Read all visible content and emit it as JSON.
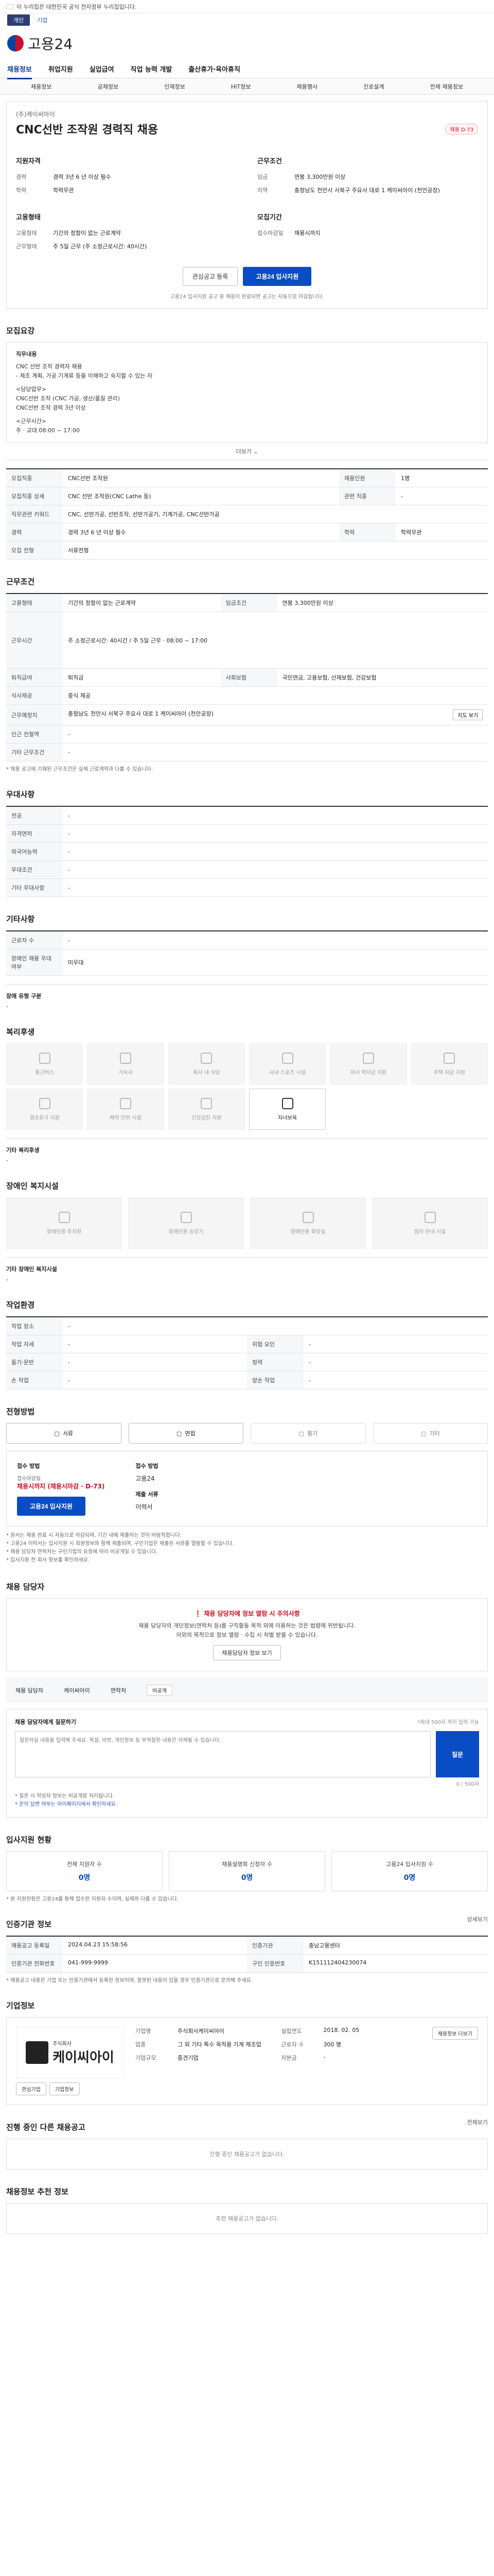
{
  "topbar": {
    "notice": "이 누리집은 대한민국 공식 전자정부 누리집입니다."
  },
  "topbar2": {
    "personal": "개인",
    "corporate": "기업"
  },
  "logo": {
    "text": "고용24"
  },
  "gnb": [
    "채용정보",
    "취업지원",
    "실업급여",
    "직업 능력 개발",
    "출산휴가·육아휴직"
  ],
  "subnav": [
    "채용정보",
    "공채정보",
    "인재정보",
    "HIT정보",
    "채용행사",
    "진로설계",
    "전체 채용정보"
  ],
  "job": {
    "company": "(주)케이씨아이",
    "title": "CNC선반 조작원 경력직 채용",
    "status_badge": "채용 D-73",
    "qual_title": "지원자격",
    "qual": [
      {
        "k": "경력",
        "v": "경력 3년 6 년 이상 필수"
      },
      {
        "k": "학력",
        "v": "학력무관"
      }
    ],
    "cond_title": "근무조건",
    "cond": [
      {
        "k": "임금",
        "v": "연봉 3,300만원 이상"
      },
      {
        "k": "지역",
        "v": "충청남도 천안시 서북구 주요사 대로 1 케이씨아이 (천안공장)"
      }
    ],
    "type_title": "고용형태",
    "type": [
      {
        "k": "고용형태",
        "v": "기간의 정함이 없는 근로계약"
      },
      {
        "k": "근무형태",
        "v": "주 5일 근무 (주 소정근로시간: 40시간)"
      }
    ],
    "deadline_title": "모집기간",
    "deadline": [
      {
        "k": "접수마감일",
        "v": "채용시까지"
      }
    ],
    "btn_interest": "관심공고 등록",
    "btn_apply": "고용24 입사지원",
    "note": "고용24 입사지원 공고 중 채용이 완료되면 공고는 자동으로 마감됩니다."
  },
  "recruit": {
    "heading": "모집요강",
    "detail_title": "직무내용",
    "detail_lines": [
      "CNC 선반 조작 경력자 채용",
      "- 제조 계획, 가공 기계류 등을 이해하고 숙지할 수 있는 자",
      "<담당업무>",
      "CNC선반 조작 (CNC 가공, 생산/품질 관리)",
      "CNC선반 조작 경력 3년 이상",
      "<근무시간>",
      "주 · 교대 08:00 ~ 17:00"
    ],
    "more": "더보기",
    "rows": [
      {
        "k": "모집직종",
        "v": "CNC선반 조작원",
        "k2": "채용인원",
        "v2": "1명"
      },
      {
        "k": "모집직종 상세",
        "v": "CNC 선반 조작원(CNC Lathe 등)",
        "k2": "관련 직종",
        "v2": "-"
      },
      {
        "k": "직무관련 키워드",
        "v": "CNC, 선반가공, 선반조작, 선반가공기, 기계가공, CNC선반가공",
        "k2": "",
        "v2": ""
      },
      {
        "k": "경력",
        "v": "경력 3년 6 년 이상 필수",
        "k2": "학력",
        "v2": "학력무관"
      },
      {
        "k": "모집 전형",
        "v": "서류전형",
        "k2": "",
        "v2": ""
      }
    ]
  },
  "work": {
    "heading": "근무조건",
    "rows": [
      {
        "k": "고용형태",
        "v": "기간의 정함이 없는 근로계약",
        "k2": "임금조건",
        "v2": "연봉 3,300만원 이상"
      },
      {
        "k": "근무시간",
        "v": "주 소정근로시간: 40시간 / 주 5일 근무 · 08:00 ~ 17:00",
        "k2": "",
        "v2": ""
      },
      {
        "k": "퇴직급여",
        "v": "퇴직금",
        "k2": "사회보험",
        "v2": "국민연금, 고용보험, 산재보험, 건강보험"
      },
      {
        "k": "식사제공",
        "v": "중식 제공",
        "k2": "",
        "v2": ""
      },
      {
        "k": "근무예정지",
        "v": "충청남도 천안시 서북구 주요사 대로 1 케이씨아이 (천안공장)",
        "k2": "",
        "v2": ""
      },
      {
        "k": "인근 전철역",
        "v": "-",
        "k2": "",
        "v2": ""
      },
      {
        "k": "기타 근무조건",
        "v": "-",
        "k2": "",
        "v2": ""
      }
    ],
    "map_btn": "지도 보기",
    "footnote": "* 채용 공고에 기재된 근무조건은 실제 근로계약과 다를 수 있습니다."
  },
  "prefer": {
    "heading": "우대사항",
    "rows": [
      {
        "k": "전공",
        "v": "-"
      },
      {
        "k": "자격면허",
        "v": "-"
      },
      {
        "k": "외국어능력",
        "v": "-"
      },
      {
        "k": "우대조건",
        "v": "-"
      },
      {
        "k": "기타 우대사항",
        "v": "-"
      }
    ]
  },
  "other": {
    "heading": "기타사항",
    "rows": [
      {
        "k": "근로자 수",
        "v": "-"
      },
      {
        "k": "장애인 채용 우대 여부",
        "v": "미우대"
      }
    ],
    "sub": "장애 유형 구분",
    "sub_v": "-"
  },
  "welfare": {
    "heading": "복리후생",
    "items": [
      "통근버스",
      "기숙사",
      "회사 내 식당",
      "사내 스포츠 시설",
      "자녀 학자금 지원",
      "주택 자금 지원",
      "경조휴가 지원",
      "체력 단련 시설",
      "건강검진 지원",
      "자녀보육"
    ],
    "active": [
      9
    ],
    "list_label": "기타 복리후생",
    "list_v": "-"
  },
  "disab": {
    "heading": "장애인 복지시설",
    "items": [
      "장애인용 주차장",
      "장애인용 승강기",
      "장애인용 화장실",
      "점자 안내 시설"
    ],
    "list_label": "기타 장애인 복지시설",
    "list_v": "-"
  },
  "env": {
    "heading": "작업환경",
    "rows": [
      {
        "k": "작업 장소",
        "v": "-",
        "k2": "",
        "v2": ""
      },
      {
        "k": "작업 자세",
        "v": "-",
        "k2": "위험 요인",
        "v2": "-"
      },
      {
        "k": "들기·운반",
        "v": "-",
        "k2": "청력",
        "v2": "-"
      },
      {
        "k": "손 작업",
        "v": "-",
        "k2": "양손 작업",
        "v2": "-"
      }
    ]
  },
  "method": {
    "heading": "전형방법",
    "items": [
      "서류",
      "면접",
      "필기",
      "기타"
    ],
    "active": [
      0,
      1
    ],
    "apply_title": "접수 방법",
    "apply_dead_label": "접수마감일",
    "apply_dead": "채용시까지 (채용시마감 · D-73)",
    "apply_btn": "고용24 입사지원",
    "docs_title": "접수 방법",
    "docs": "고용24",
    "docs2_title": "제출 서류",
    "docs2": "이력서",
    "bullets": [
      "* 원서는 채용 완료 시 자동으로 마감되며, 기간 내에 제출하는 것이 바람직합니다.",
      "* 고용24 이력서는 입사지원 시 회원정보와 함께 제출되며, 구인기업은 제출된 서류를 열람할 수 있습니다.",
      "* 채용 담당자 연락처는 구인기업의 요청에 따라 비공개일 수 있습니다.",
      "* 입사지원 전 회사 정보를 확인하세요."
    ]
  },
  "manager": {
    "heading": "채용 담당자",
    "warn_title": "채용 담당자에 정보 열람 시 주의사항",
    "warn_lines": [
      "채용 담당자의 개인정보(연락처 등)를 구직활동 목적 외에 이용하는 것은 법령에 위반됩니다.",
      "이외의 목적으로 정보 열람 · 수집 시 처벌 받을 수 있습니다."
    ],
    "warn_btn": "채용담당자 정보 보기",
    "mgr_label": "채용 담당자",
    "mgr_name": "케이씨아이",
    "mgr_phone_label": "연락처",
    "mgr_chip": "비공개",
    "q_title": "채용 담당자에게 질문하기",
    "q_note": "*최대 500자 까지 입력 가능",
    "q_placeholder": "질문하실 내용을 입력해 주세요. 욕설, 비방, 개인정보 등 부적절한 내용은 삭제될 수 있습니다.",
    "q_send": "질문",
    "q_count": "0 / 500자",
    "q_fn1": "* 질문 시 작성자 정보는 비공개로 처리됩니다.",
    "q_fn2": "* 문의 답변 여부는 마이페이지에서 확인하세요."
  },
  "stats": {
    "heading": "입사지원 현황",
    "items": [
      {
        "t": "전체 지원자 수",
        "n": "0명"
      },
      {
        "t": "채용설명회 신청자 수",
        "n": "0명"
      },
      {
        "t": "고용24 입사지원 수",
        "n": "0명"
      }
    ],
    "fn": "* 본 지원현황은 고용24를 통해 접수된 지원자 수이며, 실제와 다를 수 있습니다."
  },
  "org": {
    "heading": "인증기관 정보",
    "link": "상세보기",
    "rows": [
      {
        "k": "채용공고 등록일",
        "v": "2024.04.23 15:58:56"
      },
      {
        "k": "인증기관",
        "v": "충남고용센터"
      },
      {
        "k": "인증기관 전화번호",
        "v": "041-999-9999"
      },
      {
        "k": "구인 인증번호",
        "v": "K151112404230074"
      }
    ],
    "fn": "* 채용공고 내용은 기업 또는 인증기관에서 등록한 정보이며, 잘못된 내용이 있을 경우 인증기관으로 문의해 주세요."
  },
  "company": {
    "heading": "기업정보",
    "logo_name": "주식회사",
    "logo_big": "케이씨아이",
    "btn1": "관심기업",
    "btn2": "기업정보",
    "info": [
      {
        "k": "기업명",
        "v": "주식회사케이씨아이"
      },
      {
        "k": "설립연도",
        "v": "2018. 02. 05"
      },
      {
        "k": "업종",
        "v": "그 외 기타 특수 목적용 기계 제조업"
      },
      {
        "k": "근로자 수",
        "v": "300 명"
      },
      {
        "k": "기업규모",
        "v": "중견기업"
      },
      {
        "k": "자본금",
        "v": "-"
      }
    ],
    "more_btn": "채용정보 더보기"
  },
  "same": {
    "heading": "진행 중인 다른 채용공고",
    "link": "전체보기",
    "empty": "진행 중인 채용공고가 없습니다."
  },
  "recommend": {
    "heading": "채용정보 추천 정보",
    "empty": "추천 채용공고가 없습니다."
  }
}
